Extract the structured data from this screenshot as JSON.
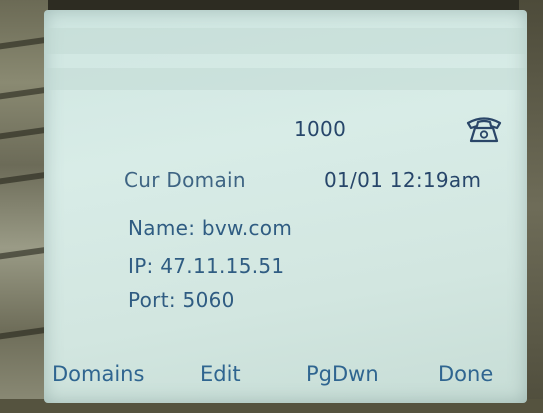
{
  "status": {
    "line_number": "1000",
    "line_icon": "telephone-icon"
  },
  "header": {
    "title": "Cur Domain",
    "datetime": "01/01 12:19am"
  },
  "details": {
    "name": "Name: bvw.com",
    "ip": "IP: 47.11.15.51",
    "port": "Port: 5060"
  },
  "softkeys": [
    {
      "label": "Domains"
    },
    {
      "label": "Edit"
    },
    {
      "label": "PgDwn"
    },
    {
      "label": "Done"
    }
  ]
}
